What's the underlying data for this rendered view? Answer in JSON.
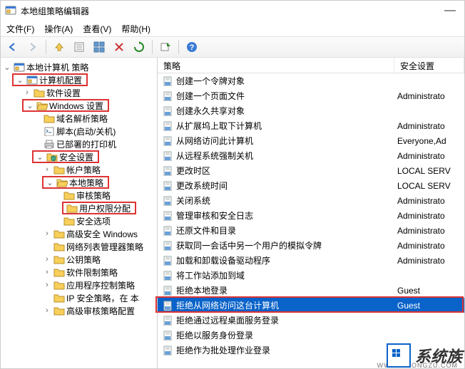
{
  "window": {
    "title": "本地组策略编辑器"
  },
  "menus": {
    "file": "文件(F)",
    "action": "操作(A)",
    "view": "查看(V)",
    "help": "帮助(H)"
  },
  "tree": {
    "root": "本地计算机 策略",
    "computer_config": "计算机配置",
    "software_settings": "软件设置",
    "windows_settings": "Windows 设置",
    "name_resolution": "域名解析策略",
    "scripts": "脚本(启动/关机)",
    "deployed_printers": "已部署的打印机",
    "security_settings": "安全设置",
    "account_policies": "帐户策略",
    "local_policies": "本地策略",
    "audit_policy": "审核策略",
    "user_rights": "用户权限分配",
    "security_options": "安全选项",
    "advanced_windows": "高级安全 Windows",
    "network_list": "网络列表管理器策略",
    "public_key": "公钥策略",
    "software_restriction": "软件限制策略",
    "app_control": "应用程序控制策略",
    "ip_security": "IP 安全策略，在 本",
    "advanced_audit": "高级审核策略配置"
  },
  "columns": {
    "policy": "策略",
    "setting": "安全设置"
  },
  "policies": [
    {
      "name": "创建一个令牌对象",
      "setting": ""
    },
    {
      "name": "创建一个页面文件",
      "setting": "Administrato"
    },
    {
      "name": "创建永久共享对象",
      "setting": ""
    },
    {
      "name": "从扩展坞上取下计算机",
      "setting": "Administrato"
    },
    {
      "name": "从网络访问此计算机",
      "setting": "Everyone,Ad"
    },
    {
      "name": "从远程系统强制关机",
      "setting": "Administrato"
    },
    {
      "name": "更改时区",
      "setting": "LOCAL SERV"
    },
    {
      "name": "更改系统时间",
      "setting": "LOCAL SERV"
    },
    {
      "name": "关闭系统",
      "setting": "Administrato"
    },
    {
      "name": "管理审核和安全日志",
      "setting": "Administrato"
    },
    {
      "name": "还原文件和目录",
      "setting": "Administrato"
    },
    {
      "name": "获取同一会话中另一个用户的模拟令牌",
      "setting": "Administrato"
    },
    {
      "name": "加载和卸载设备驱动程序",
      "setting": "Administrato"
    },
    {
      "name": "将工作站添加到域",
      "setting": ""
    },
    {
      "name": "拒绝本地登录",
      "setting": "Guest"
    },
    {
      "name": "拒绝从网络访问这台计算机",
      "setting": "Guest",
      "selected": true
    },
    {
      "name": "拒绝通过远程桌面服务登录",
      "setting": ""
    },
    {
      "name": "拒绝以服务身份登录",
      "setting": ""
    },
    {
      "name": "拒绝作为批处理作业登录",
      "setting": ""
    }
  ],
  "watermark": {
    "text": "系统族",
    "sub": "WWW.XITONGZU.COM"
  }
}
